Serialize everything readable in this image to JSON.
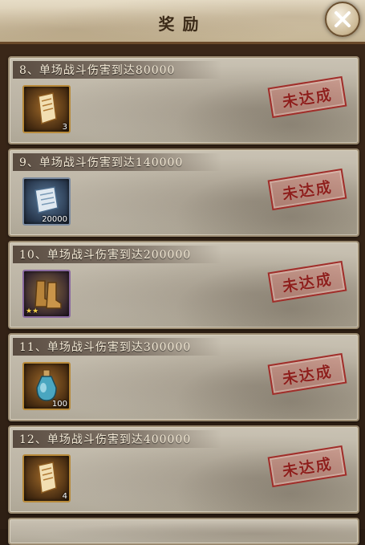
{
  "header": {
    "title": "奖励"
  },
  "tasks": [
    {
      "label": "8、单场战斗伤害到达80000",
      "reward_icon": "scroll-icon",
      "reward_qty": "3",
      "status": "未达成"
    },
    {
      "label": "9、单场战斗伤害到达140000",
      "reward_icon": "scroll-icon",
      "reward_qty": "20000",
      "status": "未达成"
    },
    {
      "label": "10、单场战斗伤害到达200000",
      "reward_icon": "boots-icon",
      "reward_qty": "",
      "status": "未达成"
    },
    {
      "label": "11、单场战斗伤害到达300000",
      "reward_icon": "potion-icon",
      "reward_qty": "100",
      "status": "未达成"
    },
    {
      "label": "12、单场战斗伤害到达400000",
      "reward_icon": "scroll-icon",
      "reward_qty": "4",
      "status": "未达成"
    }
  ],
  "colors": {
    "stamp": "#a02e2a",
    "title": "#3b2a18"
  }
}
